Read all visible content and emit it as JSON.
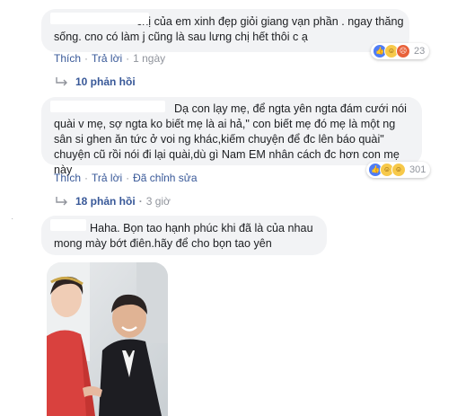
{
  "comments": [
    {
      "text": "chị của em xinh đẹp giỏi giang vạn phần . ngay thăng sống. cno có làm j cũng là sau lưng chị hết thôi c ạ",
      "actions": {
        "like": "Thích",
        "reply": "Trả lời",
        "time": "1 ngày"
      },
      "reaction_count": "23",
      "replies": "10 phản hồi"
    },
    {
      "text": "Dạ con lạy mẹ, để ngta yên ngta đám cưới nói quài v mẹ, sợ ngta ko biết mẹ là ai hả,\" con biết mẹ đó mẹ là một ng sân si ghen ăn tức ở voi ng khác,kiếm chuyện để đc lên báo quài\" chuyện cũ rồi nói đi lại quài,dù gì Nam EM nhân cách đc hơn con mẹ này",
      "actions": {
        "like": "Thích",
        "reply": "Trả lời",
        "edited": "Đã chỉnh sửa"
      },
      "reaction_count": "301",
      "replies": "18 phản hồi",
      "replies_time": "3 giờ"
    },
    {
      "text": "Haha. Bọn tao hạnh phúc khi đã là của nhau mong mày bớt điên.hãy để cho bọn tao yên"
    }
  ],
  "colors": {
    "bubble": "#f2f3f5",
    "link": "#385898",
    "muted": "#90949c",
    "photo_dress": "#d9413e",
    "photo_suit": "#1d1d22"
  },
  "icons": [
    "like-icon",
    "haha-icon",
    "angry-icon",
    "reply-arrow-icon"
  ]
}
